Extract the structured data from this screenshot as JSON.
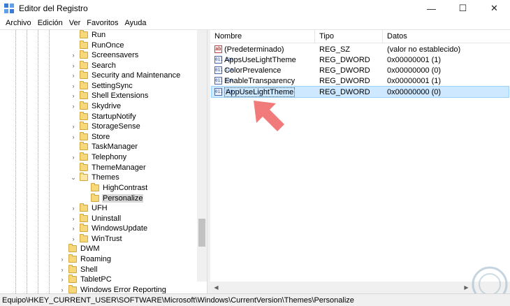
{
  "window": {
    "title": "Editor del Registro"
  },
  "titlebar_buttons": {
    "minimize": "—",
    "maximize": "☐",
    "close": "✕"
  },
  "menu": [
    "Archivo",
    "Edición",
    "Ver",
    "Favoritos",
    "Ayuda"
  ],
  "tree": [
    {
      "label": "Run",
      "chevron": ""
    },
    {
      "label": "RunOnce",
      "chevron": ""
    },
    {
      "label": "Screensavers",
      "chevron": "›"
    },
    {
      "label": "Search",
      "chevron": "›"
    },
    {
      "label": "Security and Maintenance",
      "chevron": "›"
    },
    {
      "label": "SettingSync",
      "chevron": "›"
    },
    {
      "label": "Shell Extensions",
      "chevron": "›"
    },
    {
      "label": "Skydrive",
      "chevron": "›"
    },
    {
      "label": "StartupNotify",
      "chevron": ""
    },
    {
      "label": "StorageSense",
      "chevron": "›"
    },
    {
      "label": "Store",
      "chevron": "›"
    },
    {
      "label": "TaskManager",
      "chevron": ""
    },
    {
      "label": "Telephony",
      "chevron": "›"
    },
    {
      "label": "ThemeManager",
      "chevron": ""
    },
    {
      "label": "Themes",
      "chevron": "⌄"
    },
    {
      "label": "HighContrast",
      "chevron": ""
    },
    {
      "label": "Personalize",
      "chevron": ""
    },
    {
      "label": "UFH",
      "chevron": "›"
    },
    {
      "label": "Uninstall",
      "chevron": "›"
    },
    {
      "label": "WindowsUpdate",
      "chevron": "›"
    },
    {
      "label": "WinTrust",
      "chevron": "›"
    },
    {
      "label": "DWM",
      "chevron": ""
    },
    {
      "label": "Roaming",
      "chevron": "›"
    },
    {
      "label": "Shell",
      "chevron": "›"
    },
    {
      "label": "TabletPC",
      "chevron": "›"
    },
    {
      "label": "Windows Error Reporting",
      "chevron": "›"
    }
  ],
  "list": {
    "columns": [
      "Nombre",
      "Tipo",
      "Datos"
    ],
    "rows": [
      {
        "name": "(Predeterminado)",
        "type": "REG_SZ",
        "data": "(valor no establecido)",
        "icon": "ab"
      },
      {
        "name": "AppsUseLightTheme",
        "type": "REG_DWORD",
        "data": "0x00000001 (1)",
        "icon": "bin"
      },
      {
        "name": "ColorPrevalence",
        "type": "REG_DWORD",
        "data": "0x00000000 (0)",
        "icon": "bin"
      },
      {
        "name": "EnableTransparency",
        "type": "REG_DWORD",
        "data": "0x00000001 (1)",
        "icon": "bin"
      },
      {
        "name": "AppUseLightTheme",
        "type": "REG_DWORD",
        "data": "0x00000000 (0)",
        "icon": "bin"
      }
    ],
    "selected_index": 4
  },
  "status": "Equipo\\HKEY_CURRENT_USER\\SOFTWARE\\Microsoft\\Windows\\CurrentVersion\\Themes\\Personalize",
  "icons": {
    "value_string": "ab",
    "value_binary": "011\n110"
  },
  "colors": {
    "selection": "#cde8ff",
    "folder": "#f6d77a",
    "arrow": "#f07070"
  }
}
